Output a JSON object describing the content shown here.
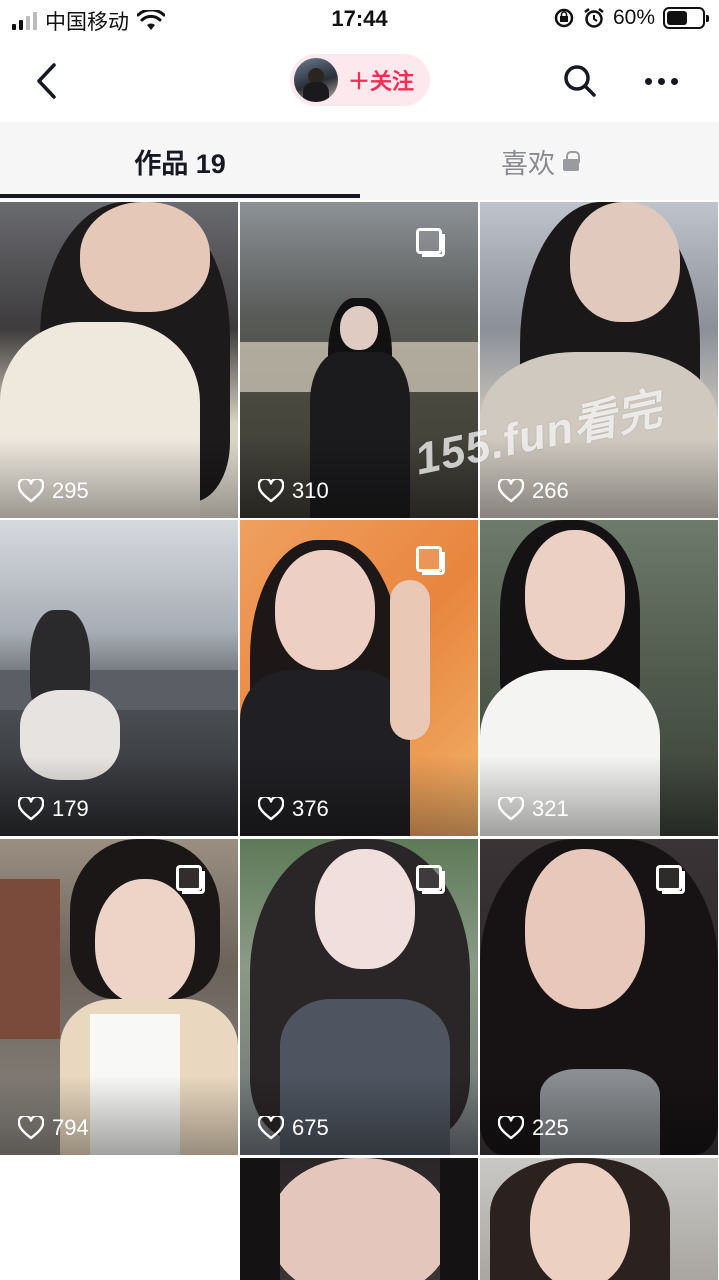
{
  "status_bar": {
    "carrier": "中国移动",
    "time": "17:44",
    "battery_percent": "60%",
    "battery_level": 0.6
  },
  "nav": {
    "back_icon": "chevron-left-icon",
    "follow_label": "＋关注",
    "search_icon": "search-icon",
    "more_icon": "more-dots-icon"
  },
  "tabs": [
    {
      "label": "作品 19",
      "active": true
    },
    {
      "label": "喜欢",
      "locked": true,
      "active": false
    }
  ],
  "posts": [
    {
      "likes": "295",
      "multi": false
    },
    {
      "likes": "310",
      "multi": true
    },
    {
      "likes": "266",
      "multi": false
    },
    {
      "likes": "179",
      "multi": false
    },
    {
      "likes": "376",
      "multi": true
    },
    {
      "likes": "321",
      "multi": false
    },
    {
      "likes": "794",
      "multi": true
    },
    {
      "likes": "675",
      "multi": true
    },
    {
      "likes": "225",
      "multi": true
    },
    {
      "likes": "",
      "multi": false
    },
    {
      "likes": "",
      "multi": false
    }
  ],
  "watermark": "155.fun看完"
}
